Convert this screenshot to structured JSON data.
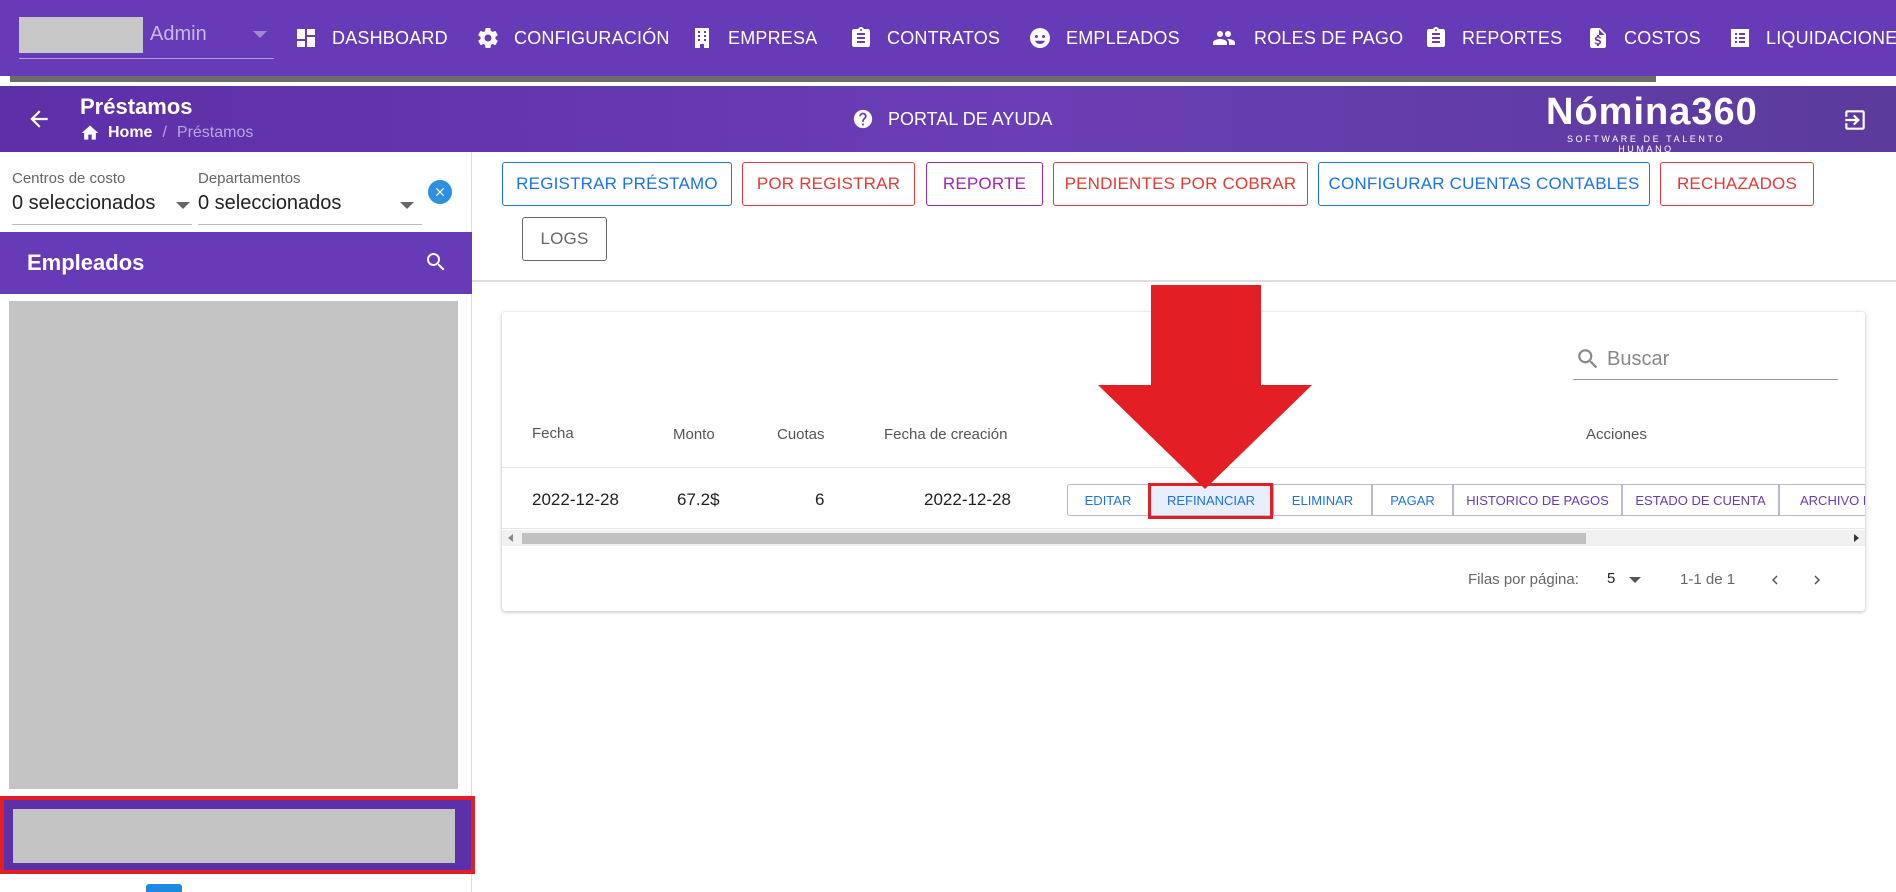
{
  "user": {
    "name": "Admin"
  },
  "nav": [
    {
      "label": "DASHBOARD",
      "icon": "dashboard-icon"
    },
    {
      "label": "CONFIGURACIÓN",
      "icon": "gear-icon"
    },
    {
      "label": "EMPRESA",
      "icon": "building-icon"
    },
    {
      "label": "CONTRATOS",
      "icon": "clipboard-icon"
    },
    {
      "label": "EMPLEADOS",
      "icon": "face-icon"
    },
    {
      "label": "ROLES DE PAGO",
      "icon": "people-icon"
    },
    {
      "label": "REPORTES",
      "icon": "clipboard-icon"
    },
    {
      "label": "COSTOS",
      "icon": "file-dollar-icon"
    },
    {
      "label": "LIQUIDACIONE",
      "icon": "list-icon"
    }
  ],
  "header": {
    "title": "Préstamos",
    "breadcrumb": {
      "home": "Home",
      "separator": "/",
      "current": "Préstamos"
    },
    "help_label": "PORTAL DE AYUDA",
    "brand": {
      "name": "Nómina360",
      "tagline": "SOFTWARE DE TALENTO HUMANO"
    }
  },
  "filters": {
    "cost_centers": {
      "label": "Centros de costo",
      "value": "0 seleccionados"
    },
    "departments": {
      "label": "Departamentos",
      "value": "0 seleccionados"
    }
  },
  "employees_panel": {
    "title": "Empleados"
  },
  "actions": [
    {
      "label": "REGISTRAR PRÉSTAMO",
      "color": "#1a73e8"
    },
    {
      "label": "POR REGISTRAR",
      "color": "#e53935"
    },
    {
      "label": "REPORTE",
      "color": "#9c27b0"
    },
    {
      "label": "PENDIENTES POR COBRAR",
      "color": "#e53935"
    },
    {
      "label": "CONFIGURAR CUENTAS CONTABLES",
      "color": "#1a73e8"
    },
    {
      "label": "RECHAZADOS",
      "color": "#e53935"
    },
    {
      "label": "LOGS",
      "color": "#666666"
    }
  ],
  "table": {
    "search_placeholder": "Buscar",
    "headers": {
      "fecha": "Fecha",
      "monto": "Monto",
      "cuotas": "Cuotas",
      "fecha_creacion": "Fecha de creación",
      "acciones": "Acciones"
    },
    "rows": [
      {
        "fecha": "2022-12-28",
        "monto": "67.2$",
        "cuotas": "6",
        "fecha_creacion": "2022-12-28"
      }
    ],
    "row_actions": [
      {
        "label": "EDITAR",
        "color": "#1a73e8"
      },
      {
        "label": "REFINANCIAR",
        "color": "#1a73e8"
      },
      {
        "label": "ELIMINAR",
        "color": "#1a73e8"
      },
      {
        "label": "PAGAR",
        "color": "#1a73e8"
      },
      {
        "label": "HISTORICO DE PAGOS",
        "color": "#673ab7"
      },
      {
        "label": "ESTADO DE CUENTA",
        "color": "#673ab7"
      },
      {
        "label": "ARCHIVO BA",
        "color": "#673ab7"
      }
    ],
    "pagination": {
      "rows_label": "Filas por página:",
      "rows_per_page": "5",
      "range": "1-1 de 1"
    }
  },
  "annotation_color": "#e31e24"
}
